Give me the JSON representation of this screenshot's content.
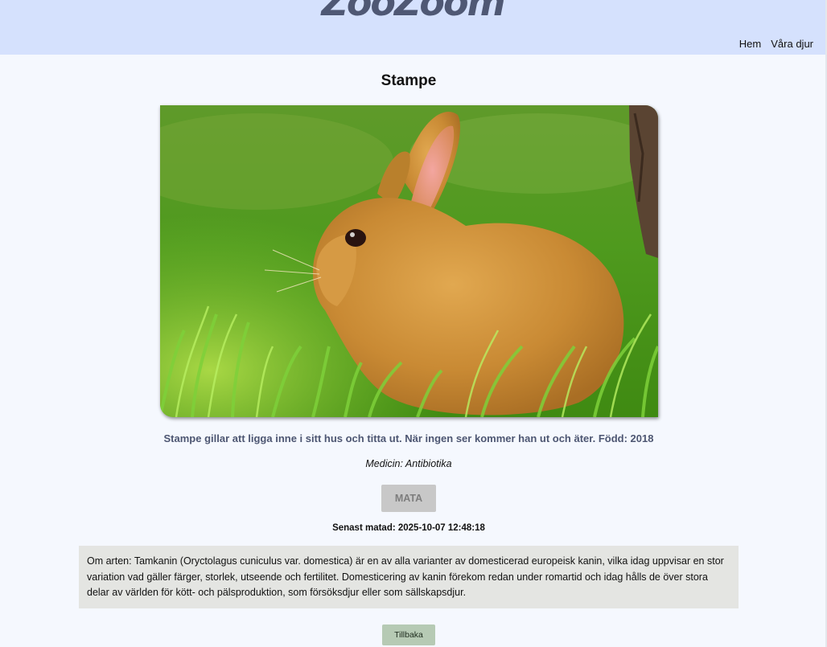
{
  "header": {
    "logo_text": "ZooZoom",
    "nav": [
      "Hem",
      "Våra djur"
    ]
  },
  "animal": {
    "name": "Stampe",
    "image_alt": "Stampe",
    "description": "Stampe gillar att ligga inne i sitt hus och titta ut. När ingen ser kommer han ut och äter. Född: 2018",
    "medicine": "Medicin: Antibiotika",
    "feed_button": "MATA",
    "last_fed": "Senast matad: 2025-10-07 12:48:18",
    "about": "Om arten: Tamkanin (Oryctolagus cuniculus var. domestica) är en av alla varianter av domesticerad europeisk kanin, vilka idag uppvisar en stor variation vad gäller färger, storlek, utseende och fertilitet. Domesticering av kanin förekom redan under romartid och idag hålls de över stora delar av världen för kött- och pälsproduktion, som försöksdjur eller som sällskapsdjur.",
    "back_button": "Tillbaka"
  },
  "colors": {
    "header_bg": "#d5e1fd",
    "page_bg": "#f5f8fe",
    "description_text": "#4d5672",
    "feed_button_disabled": "#c8c8c8",
    "about_bg": "#e4e5e2",
    "back_button_bg": "#b6cab4"
  }
}
